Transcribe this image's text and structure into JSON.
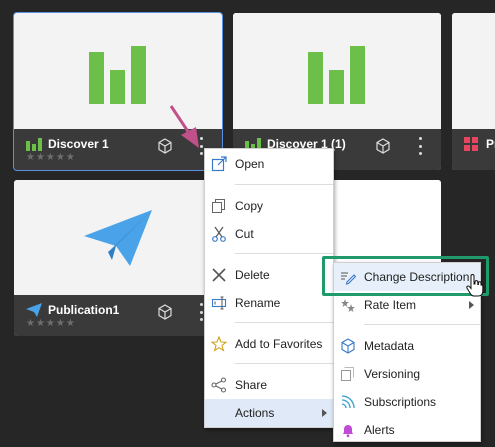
{
  "tiles": [
    {
      "title": "Discover 1",
      "type": "discover",
      "rating": "★★★★★",
      "selected": true
    },
    {
      "title": "Discover 1 (1)",
      "type": "discover",
      "rating": "★★★★★"
    },
    {
      "title": "Pr",
      "type": "report",
      "rating": ""
    },
    {
      "title": "Publication1",
      "type": "publication",
      "rating": "★★★★★"
    },
    {
      "title": "",
      "type": "blank",
      "rating": ""
    }
  ],
  "context_menu": {
    "items": [
      {
        "label": "Open",
        "icon": "open-icon"
      },
      {
        "label": "Copy",
        "icon": "copy-icon"
      },
      {
        "label": "Cut",
        "icon": "cut-icon"
      },
      {
        "label": "Delete",
        "icon": "delete-icon"
      },
      {
        "label": "Rename",
        "icon": "rename-icon"
      },
      {
        "label": "Add to Favorites",
        "icon": "star-icon"
      },
      {
        "label": "Share",
        "icon": "share-icon"
      },
      {
        "label": "Actions",
        "icon": "",
        "has_submenu": true,
        "highlighted": true
      }
    ]
  },
  "actions_submenu": {
    "items": [
      {
        "label": "Change Description",
        "icon": "edit-description-icon",
        "highlighted": true
      },
      {
        "label": "Rate Item",
        "icon": "rate-icon",
        "has_submenu": true
      },
      {
        "label": "Metadata",
        "icon": "metadata-icon"
      },
      {
        "label": "Versioning",
        "icon": "versioning-icon"
      },
      {
        "label": "Subscriptions",
        "icon": "subscriptions-icon"
      },
      {
        "label": "Alerts",
        "icon": "bell-icon"
      }
    ]
  },
  "colors": {
    "background": "#262626",
    "tile_footer": "#3a3a3a",
    "discover_green": "#6cc04a",
    "publication_blue": "#4aa3e8",
    "report_red": "#e8455f",
    "selection_blue": "#5b8fe0",
    "menu_highlight": "#dfe9f7",
    "callout_green": "#1f9a6a",
    "pointer_arrow": "#c0508a"
  }
}
